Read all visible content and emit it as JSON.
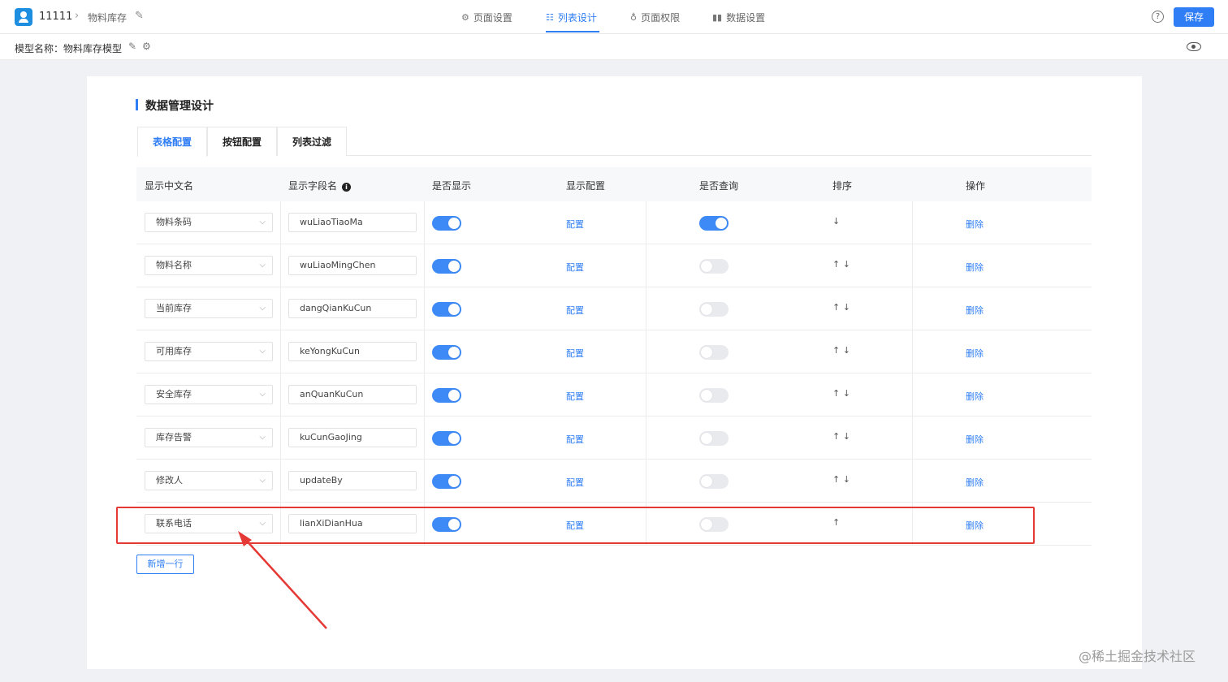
{
  "header": {
    "app_id": "11111",
    "crumb_sep": "›",
    "page_name": "物料库存",
    "nav": [
      {
        "icon": "⚙",
        "label": "页面设置"
      },
      {
        "icon": "☷",
        "label": "列表设计"
      },
      {
        "icon": "♁",
        "label": "页面权限"
      },
      {
        "icon": "▮▮",
        "label": "数据设置"
      }
    ],
    "help": "?",
    "save": "保存"
  },
  "subbar": {
    "model_label": "模型名称：物料库存模型"
  },
  "card": {
    "title": "数据管理设计",
    "tabs": [
      "表格配置",
      "按钮配置",
      "列表过滤"
    ],
    "columns": [
      "显示中文名",
      "显示字段名",
      "是否显示",
      "显示配置",
      "是否查询",
      "排序",
      "操作"
    ],
    "info": "i",
    "rows": [
      {
        "name": "物料条码",
        "field": "wuLiaoTiaoMa",
        "show": true,
        "config": "配置",
        "query": true,
        "sort": "↓",
        "action": "删除"
      },
      {
        "name": "物料名称",
        "field": "wuLiaoMingChen",
        "show": true,
        "config": "配置",
        "query": false,
        "sort": "↑ ↓",
        "action": "删除"
      },
      {
        "name": "当前库存",
        "field": "dangQianKuCun",
        "show": true,
        "config": "配置",
        "query": false,
        "sort": "↑ ↓",
        "action": "删除"
      },
      {
        "name": "可用库存",
        "field": "keYongKuCun",
        "show": true,
        "config": "配置",
        "query": false,
        "sort": "↑ ↓",
        "action": "删除"
      },
      {
        "name": "安全库存",
        "field": "anQuanKuCun",
        "show": true,
        "config": "配置",
        "query": false,
        "sort": "↑ ↓",
        "action": "删除"
      },
      {
        "name": "库存告警",
        "field": "kuCunGaoJing",
        "show": true,
        "config": "配置",
        "query": false,
        "sort": "↑ ↓",
        "action": "删除"
      },
      {
        "name": "修改人",
        "field": "updateBy",
        "show": true,
        "config": "配置",
        "query": false,
        "sort": "↑ ↓",
        "action": "删除"
      },
      {
        "name": "联系电话",
        "field": "lianXiDianHua",
        "show": true,
        "config": "配置",
        "query": false,
        "sort": "↑",
        "action": "删除"
      }
    ],
    "add_row": "新增一行"
  },
  "watermark": "@稀土掘金技术社区",
  "colors": {
    "accent": "#2f7ef5",
    "highlight": "#e53935"
  }
}
